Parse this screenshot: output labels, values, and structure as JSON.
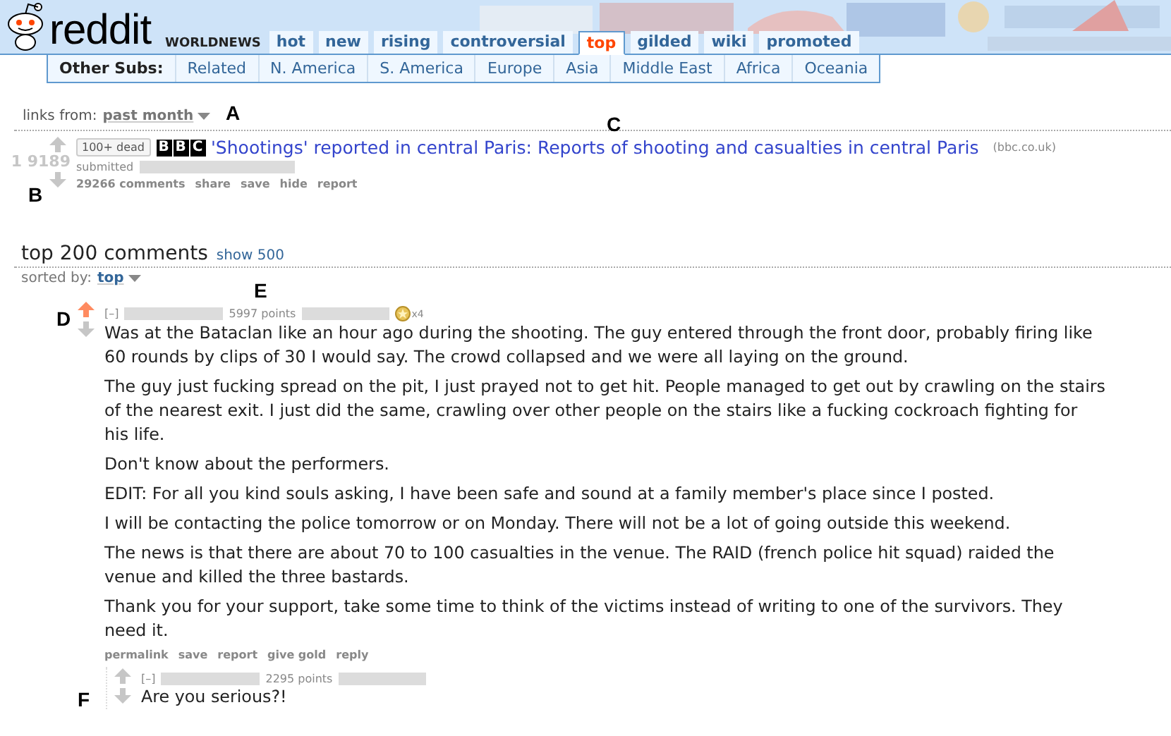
{
  "header": {
    "logo_text": "reddit",
    "subreddit": "WORLDNEWS",
    "tabs": [
      {
        "label": "hot",
        "selected": false
      },
      {
        "label": "new",
        "selected": false
      },
      {
        "label": "rising",
        "selected": false
      },
      {
        "label": "controversial",
        "selected": false
      },
      {
        "label": "top",
        "selected": true
      },
      {
        "label": "gilded",
        "selected": false
      },
      {
        "label": "wiki",
        "selected": false
      },
      {
        "label": "promoted",
        "selected": false
      }
    ]
  },
  "sub_nav": {
    "label": "Other Subs:",
    "items": [
      "Related",
      "N. America",
      "S. America",
      "Europe",
      "Asia",
      "Middle East",
      "Africa",
      "Oceania"
    ]
  },
  "time_filter": {
    "label": "links from:",
    "value": "past month"
  },
  "post": {
    "score": "1 9189",
    "flair": "100+ dead",
    "source_badge": [
      "B",
      "B",
      "C"
    ],
    "title": "'Shootings' reported in central Paris: Reports of shooting and casualties in central Paris",
    "domain": "(bbc.co.uk)",
    "submitted": "submitted",
    "actions": [
      "29266 comments",
      "share",
      "save",
      "hide",
      "report"
    ]
  },
  "comments_header": {
    "title": "top 200 comments",
    "show_more": "show 500",
    "sort_label": "sorted by:",
    "sort_value": "top"
  },
  "comments": [
    {
      "toggle": "[–]",
      "points": "5997 points",
      "upvoted": true,
      "gilded_count": "x4",
      "paragraphs": [
        "Was at the Bataclan like an hour ago during the shooting. The guy entered through the front door, probably firing like 60 rounds by clips of 30 I would say. The crowd collapsed and we were all laying on the ground.",
        "The guy just fucking spread on the pit, I just prayed not to get hit. People managed to get out by crawling on the stairs of the nearest exit. I just did the same, crawling over other people on the stairs like a fucking cockroach fighting for his life.",
        "Don't know about the performers.",
        "EDIT: For all you kind souls asking, I have been safe and sound at a family member's place since I posted.",
        "I will be contacting the police tomorrow or on Monday. There will not be a lot of going outside this weekend.",
        "The news is that there are about 70 to 100 casualties in the venue. The RAID (french police hit squad) raided the venue and killed the three bastards.",
        "Thank you for your support, take some time to think of the victims instead of writing to one of the survivors. They need it."
      ],
      "actions": [
        "permalink",
        "save",
        "report",
        "give gold",
        "reply"
      ],
      "children": [
        {
          "toggle": "[–]",
          "points": "2295 points",
          "upvoted": false,
          "paragraphs": [
            "Are you serious?!"
          ]
        }
      ]
    }
  ],
  "annotations": [
    "A",
    "B",
    "C",
    "D",
    "E",
    "F"
  ]
}
